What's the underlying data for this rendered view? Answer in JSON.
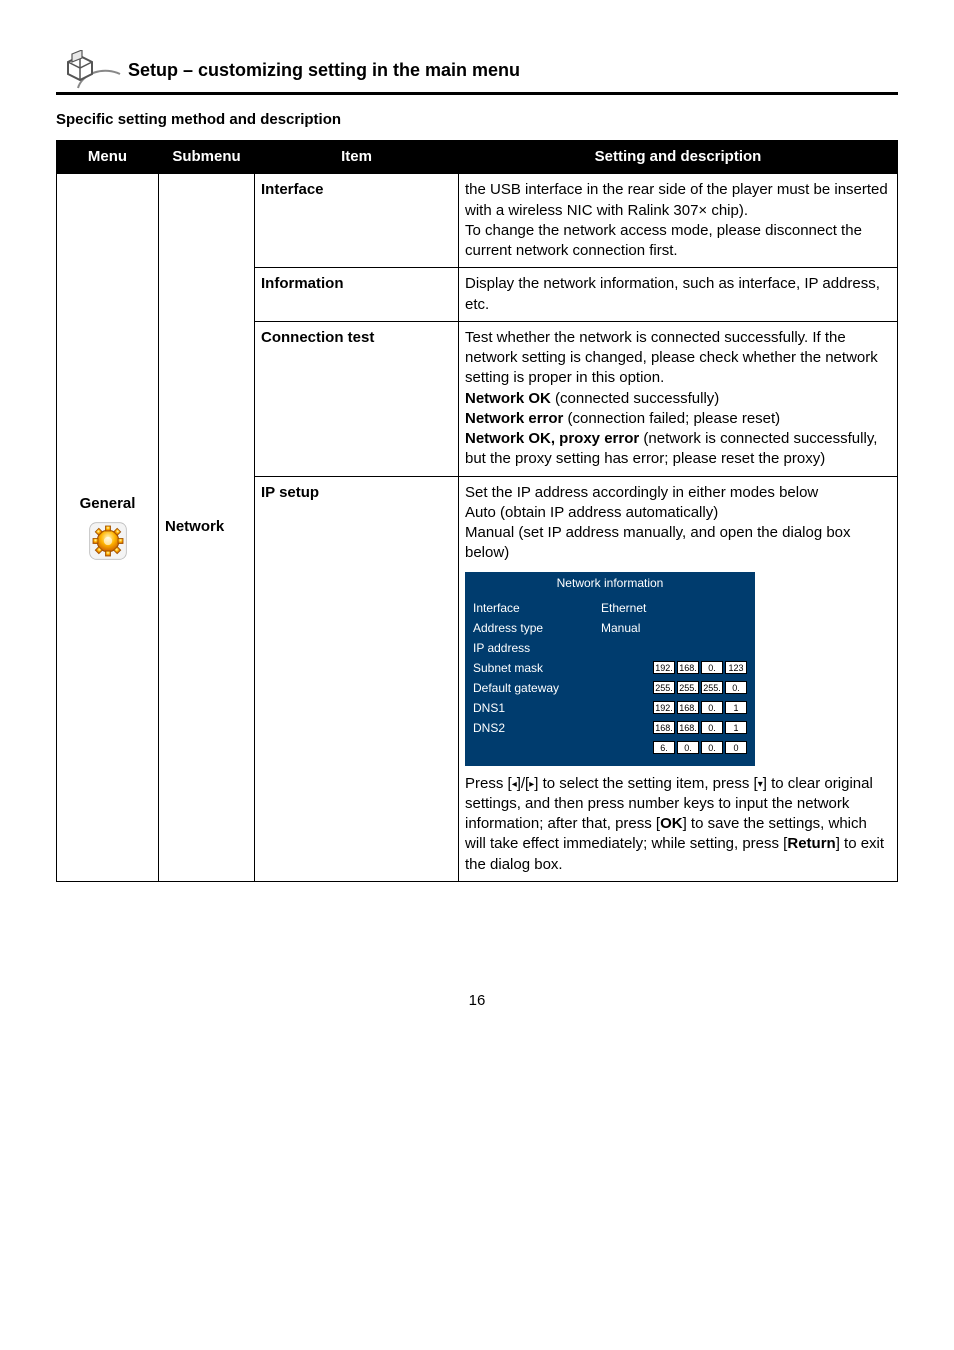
{
  "header": {
    "title": "Setup – customizing setting in the main menu"
  },
  "subheading": "Specific setting method and description",
  "table": {
    "headers": {
      "menu": "Menu",
      "submenu": "Submenu",
      "item": "Item",
      "desc": "Setting and description"
    },
    "menu": "General",
    "submenu": "Network",
    "rows": {
      "interface": {
        "item": "Interface",
        "desc_l1": "the USB interface in the rear side of the player must be inserted with a wireless NIC with Ralink 307× chip).",
        "desc_l2": "To change the network access mode, please disconnect the current network connection first."
      },
      "information": {
        "item": "Information",
        "desc": "Display the network information, such as interface, IP address, etc."
      },
      "connection": {
        "item": "Connection test",
        "desc_l1": "Test whether the network is connected successfully. If the network setting is changed, please check whether the network setting is proper in this option.",
        "l2a": "Network OK",
        "l2b": " (connected successfully)",
        "l3a": "Network error",
        "l3b": " (connection failed; please reset)",
        "l4a": "Network OK, proxy error",
        "l4b": " (network is connected successfully, but the proxy setting has error; please reset the proxy)"
      },
      "ip": {
        "item": "IP setup",
        "desc_l1": "Set the IP address accordingly in either modes below",
        "desc_l2": "Auto (obtain IP address automatically)",
        "desc_l3": "Manual (set IP address manually, and open the dialog box below)",
        "box": {
          "title": "Network information",
          "interface_l": "Interface",
          "interface_v": "Ethernet",
          "type_l": "Address type",
          "type_v": "Manual",
          "ip_l": "IP address",
          "ip_v": [
            "192.",
            "168.",
            "0.",
            "123"
          ],
          "mask_l": "Subnet mask",
          "mask_v": [
            "255.",
            "255.",
            "255.",
            "0."
          ],
          "gw_l": "Default gateway",
          "gw_v": [
            "192.",
            "168.",
            "0.",
            "1"
          ],
          "dns1_l": "DNS1",
          "dns1_v": [
            "168.",
            "168.",
            "0.",
            "1"
          ],
          "dns2_l": "DNS2",
          "dns2_v": [
            "6.",
            "0.",
            "0.",
            "0"
          ]
        },
        "foot_pre": "Press [",
        "foot_a1": "◂",
        "foot_mid1": "]/[",
        "foot_a2": "▸",
        "foot_mid2": "] to select the setting item, press [",
        "foot_a3": "▾",
        "foot_mid3": "] to clear original settings, and then press number keys to input the network information; after that, press [",
        "foot_ok": "OK",
        "foot_mid4": "] to save the settings, which will take effect immediately; while setting, press [",
        "foot_ret": "Return",
        "foot_end": "] to exit the dialog box."
      }
    }
  },
  "pagenum": "16"
}
